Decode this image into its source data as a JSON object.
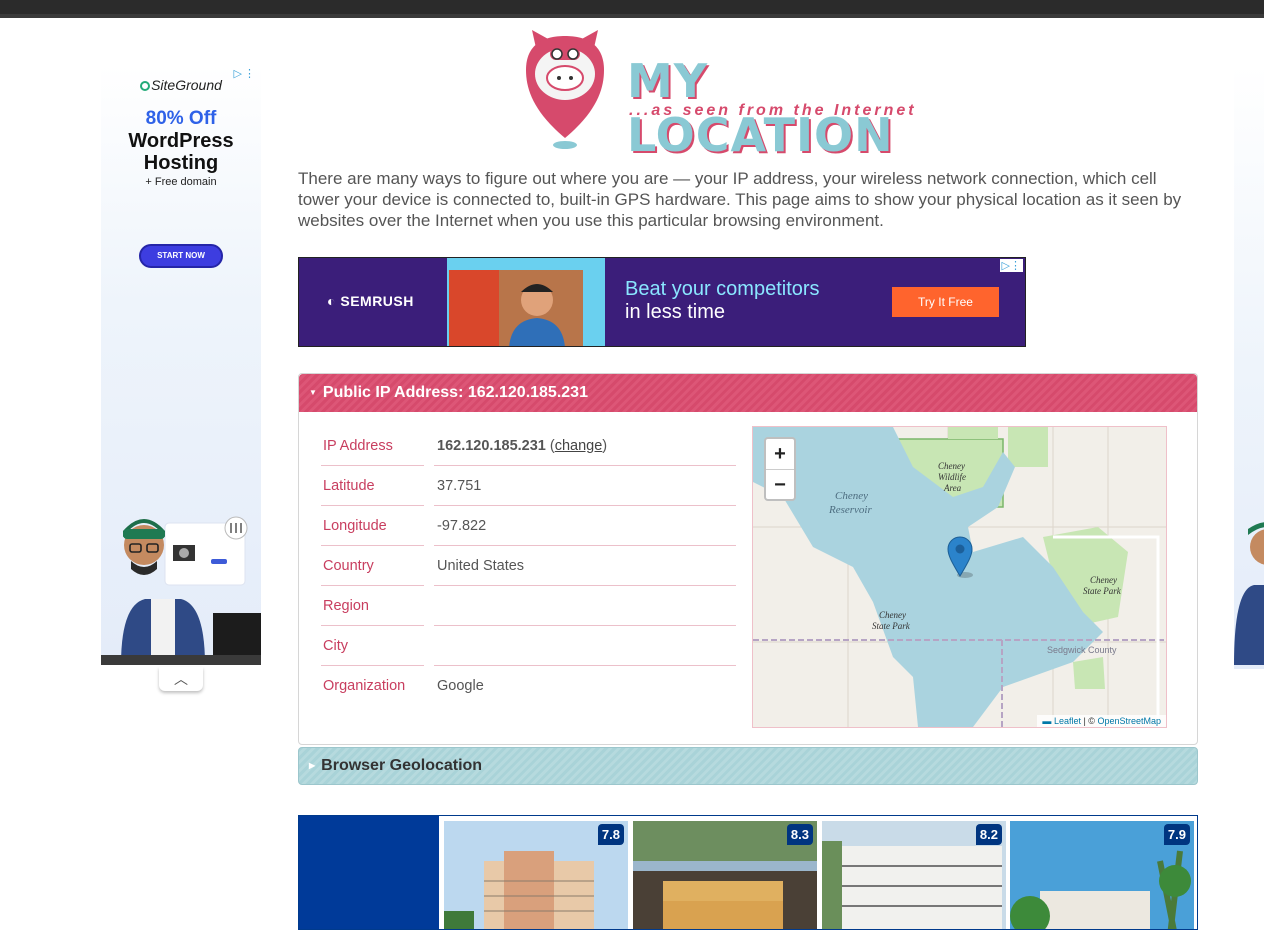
{
  "ads": {
    "left": {
      "brand": "SiteGround",
      "headline": "80% Off",
      "product_line1": "WordPress",
      "product_line2": "Hosting",
      "extra": "+ Free domain",
      "cta": "START NOW"
    },
    "banner": {
      "brand": "SEMRUSH",
      "headline_line1": "Beat your competitors",
      "headline_line2": "in less time",
      "cta": "Try It Free"
    },
    "hotels": {
      "scores": [
        "7.8",
        "8.3",
        "8.2",
        "7.9"
      ]
    }
  },
  "logo": {
    "title": "MY LOCATION",
    "subtitle": "...as seen from the Internet"
  },
  "intro": "There are many ways to figure out where you are — your IP address, your wireless network connection, which cell tower your device is connected to, built-in GPS hardware. This page aims to show your physical location as it seen by websites over the Internet when you use this particular browsing environment.",
  "ip_panel": {
    "title": "Public IP Address: 162.120.185.231",
    "rows": [
      {
        "label": "IP Address",
        "value": "162.120.185.231"
      },
      {
        "label": "Latitude",
        "value": "37.751"
      },
      {
        "label": "Longitude",
        "value": "-97.822"
      },
      {
        "label": "Country",
        "value": "United States"
      },
      {
        "label": "Region",
        "value": ""
      },
      {
        "label": "City",
        "value": ""
      },
      {
        "label": "Organization",
        "value": "Google"
      }
    ],
    "change_link": "change",
    "map": {
      "zoom_in": "+",
      "zoom_out": "−",
      "labels": {
        "wildlife": "Cheney Wildlife Area",
        "reservoir": "Cheney Reservoir",
        "state_park_east": "Cheney State Park",
        "state_park_west": "Cheney State Park",
        "county": "Sedgwick County"
      },
      "attribution_leaflet": "Leaflet",
      "attribution_sep": " | © ",
      "attribution_osm": "OpenStreetMap"
    }
  },
  "geo_panel": {
    "title": "Browser Geolocation"
  },
  "colors": {
    "accent_pink": "#d64a6c",
    "accent_teal": "#8ac9d4",
    "water": "#aad3df",
    "park": "#c8e6b4"
  }
}
